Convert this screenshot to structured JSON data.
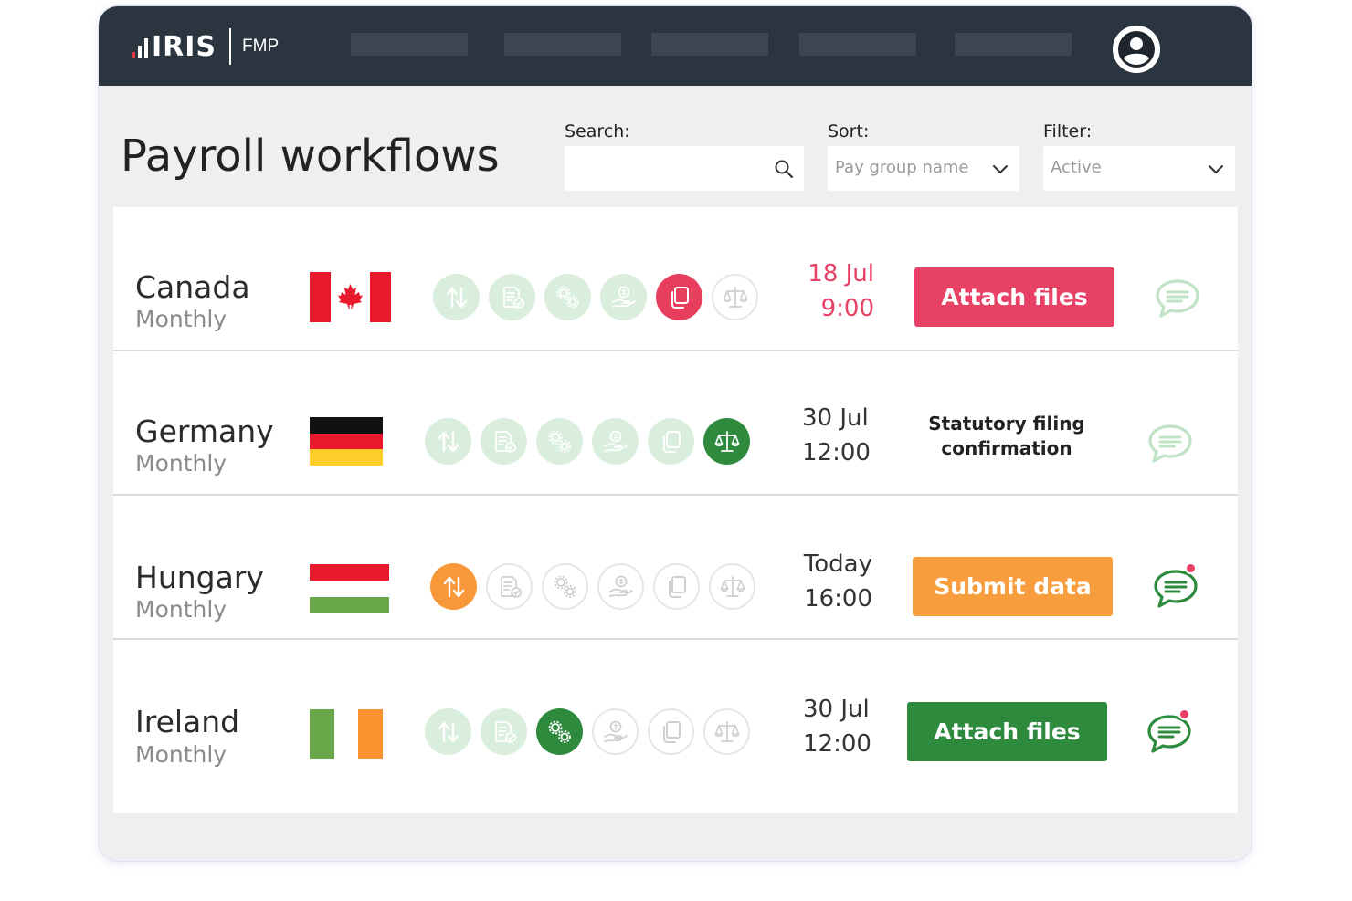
{
  "app": {
    "logo_text": "IRIS",
    "logo_sub": "FMP"
  },
  "page": {
    "title": "Payroll workflows"
  },
  "controls": {
    "search_label": "Search:",
    "search_value": "",
    "sort_label": "Sort:",
    "sort_value": "Pay group name",
    "filter_label": "Filter:",
    "filter_value": "Active"
  },
  "colors": {
    "topbar": "#2b3540",
    "accent_red": "#e84166",
    "accent_green": "#2e8b3e",
    "accent_orange": "#f89d3d",
    "pale_green": "#d9eedc"
  },
  "workflow_steps": [
    "transfer-arrows-icon",
    "document-check-icon",
    "gears-icon",
    "payment-hand-icon",
    "copy-documents-icon",
    "scales-icon"
  ],
  "rows": [
    {
      "country": "Canada",
      "frequency": "Monthly",
      "date_line1": "18 Jul",
      "date_line2": "9:00",
      "action_label": "Attach files"
    },
    {
      "country": "Germany",
      "frequency": "Monthly",
      "date_line1": "30 Jul",
      "date_line2": "12:00",
      "status_line1": "Statutory filing",
      "status_line2": "confirmation"
    },
    {
      "country": "Hungary",
      "frequency": "Monthly",
      "date_line1": "Today",
      "date_line2": "16:00",
      "action_label": "Submit data"
    },
    {
      "country": "Ireland",
      "frequency": "Monthly",
      "date_line1": "30 Jul",
      "date_line2": "12:00",
      "action_label": "Attach files"
    }
  ]
}
